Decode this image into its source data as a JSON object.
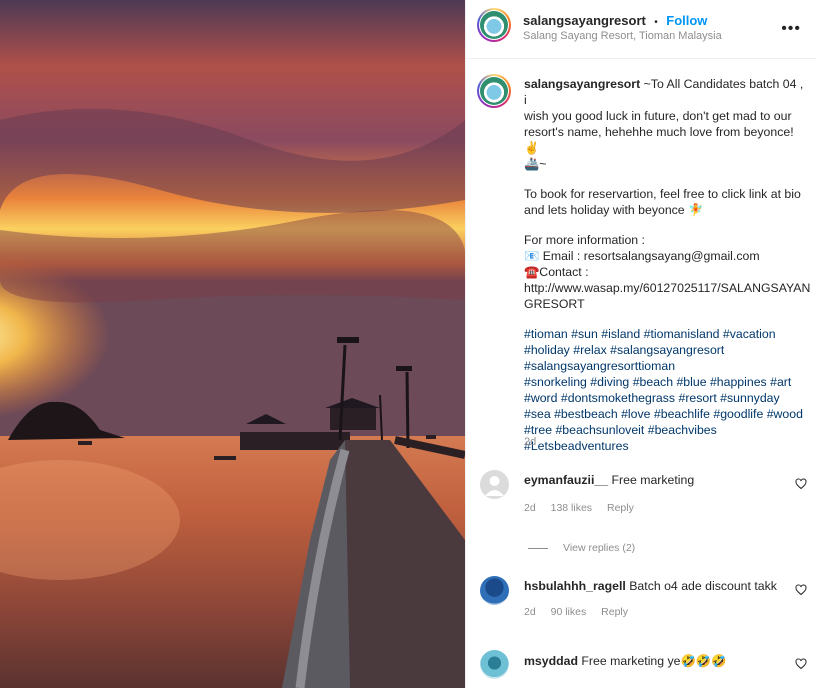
{
  "post": {
    "username": "salangsayangresort",
    "separator": "•",
    "follow_label": "Follow",
    "location": "Salang Sayang Resort, Tioman Malaysia",
    "more_icon": "more-dots-icon",
    "caption_lines": [
      "~To All Candidates batch 04 , i",
      "wish you good luck in future, don't get mad to our",
      "resort's name, hehehhe much love from beyonce! ✌",
      "🚢~"
    ],
    "booking_lines": [
      "To book for reservartion, feel free to click link at bio",
      "and lets holiday with beyonce 🧚"
    ],
    "info_lines": [
      "For more information :",
      "📧 Email : resortsalangsayang@gmail.com",
      "☎️Contact :",
      "http://www.wasap.my/60127025117/SALANGSAYAN",
      "GRESORT"
    ],
    "hashtag_lines": [
      "#tioman #sun #island #tiomanisland #vacation",
      "#holiday #relax #salangsayangresort",
      "#salangsayangresorttioman",
      "#snorkeling #diving #beach #blue #happines #art",
      "#word #dontsmokethegrass #resort #sunnyday",
      "#sea #bestbeach #love #beachlife #goodlife #wood",
      "#tree #beachsunloveit #beachvibes",
      "#Letsbeadventures"
    ],
    "time_ago": "2d"
  },
  "comments": [
    {
      "username": "eymanfauzii__",
      "text": "Free marketing",
      "time": "2d",
      "likes": "138 likes",
      "reply": "Reply",
      "view_replies": "View replies (2)"
    },
    {
      "username": "hsbulahhh_ragell",
      "text": "Batch o4 ade discount takk",
      "time": "2d",
      "likes": "90 likes",
      "reply": "Reply"
    },
    {
      "username": "msyddad",
      "text": "Free marketing ye🤣🤣🤣"
    }
  ]
}
